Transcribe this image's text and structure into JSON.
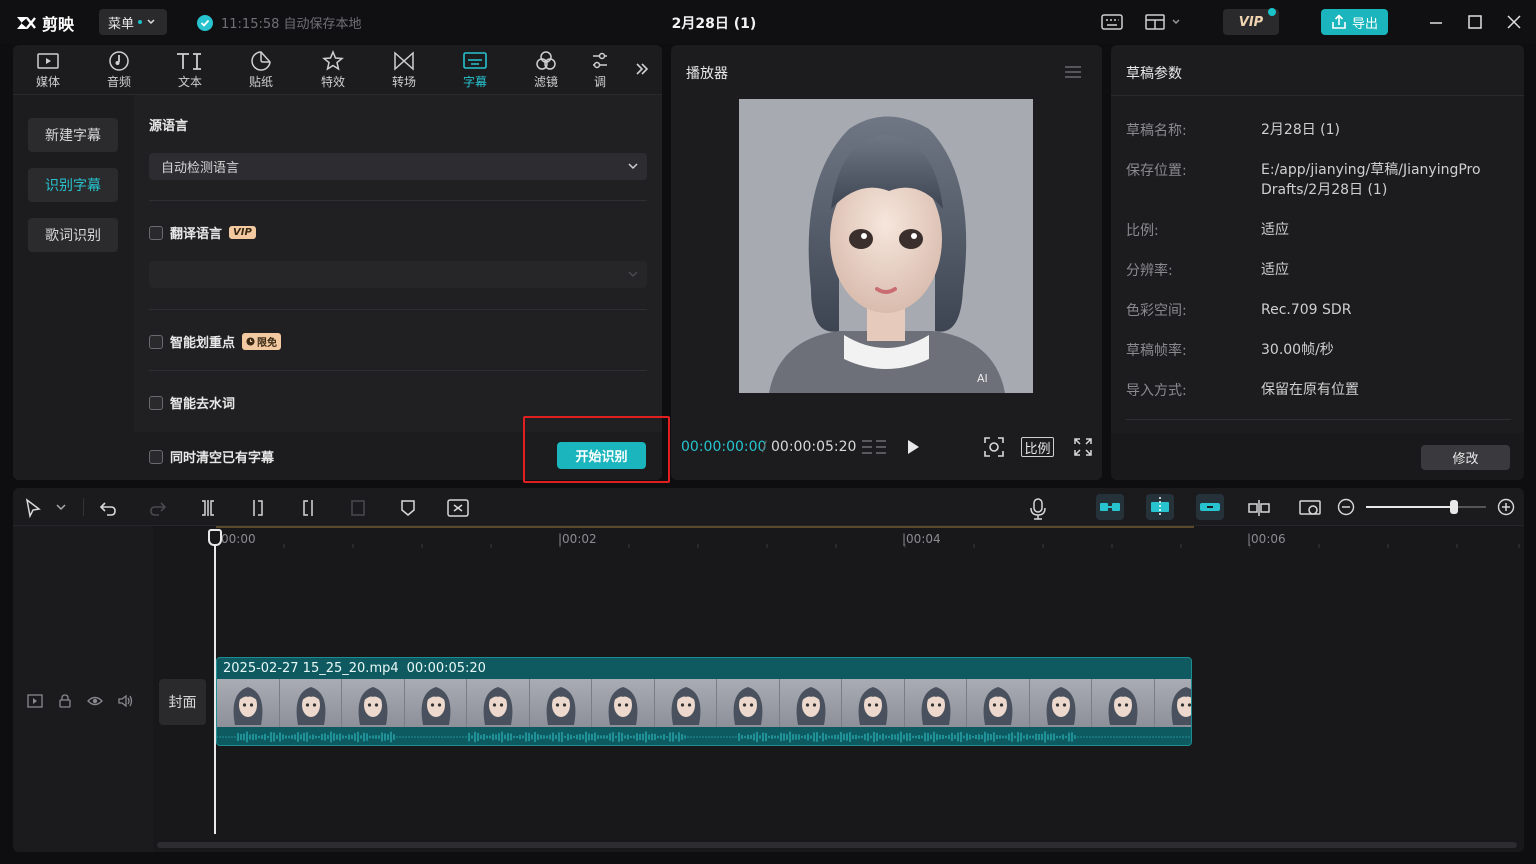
{
  "titlebar": {
    "logo_text": "剪映",
    "menu_label": "菜单",
    "autosave_text": "11:15:58 自动保存本地",
    "project_title": "2月28日 (1)",
    "vip_label": "VIP",
    "export_label": "导出"
  },
  "tabs": [
    {
      "label": "媒体",
      "icon": "media-icon"
    },
    {
      "label": "音频",
      "icon": "audio-icon"
    },
    {
      "label": "文本",
      "icon": "text-icon"
    },
    {
      "label": "贴纸",
      "icon": "sticker-icon"
    },
    {
      "label": "特效",
      "icon": "effects-icon"
    },
    {
      "label": "转场",
      "icon": "transition-icon"
    },
    {
      "label": "字幕",
      "icon": "subtitle-icon",
      "active": true
    },
    {
      "label": "滤镜",
      "icon": "filter-icon"
    },
    {
      "label": "调",
      "icon": "adjust-icon"
    }
  ],
  "subnav": {
    "new_caption": "新建字幕",
    "recognize_caption": "识别字幕",
    "lyrics_recognize": "歌词识别"
  },
  "recognize": {
    "source_language_label": "源语言",
    "source_language_value": "自动检测语言",
    "translate_label": "翻译语言",
    "translate_tag": "VIP",
    "highlight_label": "智能划重点",
    "highlight_tag": "限免",
    "remove_filler_label": "智能去水词",
    "clear_existing_label": "同时清空已有字幕",
    "start_button": "开始识别"
  },
  "player": {
    "title": "播放器",
    "current_time": "00:00:00:00",
    "total_time": "00:00:05:20",
    "ratio_label": "比例"
  },
  "draft": {
    "title": "草稿参数",
    "rows": [
      {
        "key": "草稿名称:",
        "value": "2月28日 (1)"
      },
      {
        "key": "保存位置:",
        "value": "E:/app/jianying/草稿/JianyingPro Drafts/2月28日 (1)"
      },
      {
        "key": "比例:",
        "value": "适应"
      },
      {
        "key": "分辨率:",
        "value": "适应"
      },
      {
        "key": "色彩空间:",
        "value": "Rec.709 SDR"
      },
      {
        "key": "草稿帧率:",
        "value": "30.00帧/秒"
      },
      {
        "key": "导入方式:",
        "value": "保留在原有位置"
      }
    ],
    "modify_button": "修改"
  },
  "timeline": {
    "ruler_labels": [
      "00:00",
      "|00:02",
      "|00:04",
      "|00:06"
    ],
    "clip_name": "2025-02-27 15_25_20.mp4",
    "clip_duration": "00:00:05:20",
    "cover_label": "封面",
    "zoom_level": 0.7
  },
  "colors": {
    "accent": "#1bb5bd",
    "highlight_box": "#e02020"
  }
}
